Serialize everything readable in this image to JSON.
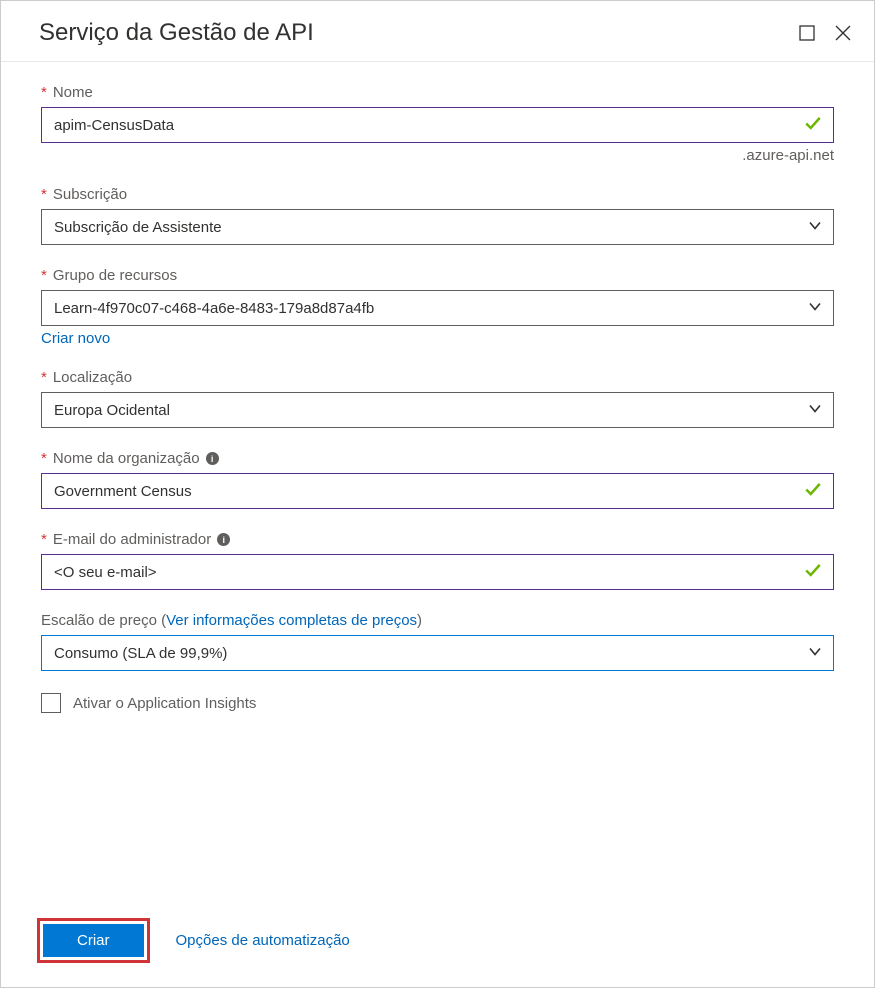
{
  "header": {
    "title": "Serviço da Gestão de API"
  },
  "form": {
    "name": {
      "label": "Nome",
      "value": "apim-CensusData",
      "suffix": ".azure-api.net"
    },
    "subscription": {
      "label": "Subscrição",
      "value": "Subscrição de Assistente"
    },
    "resourceGroup": {
      "label": "Grupo de recursos",
      "value": "Learn-4f970c07-c468-4a6e-8483-179a8d87a4fb",
      "createNew": "Criar novo"
    },
    "location": {
      "label": "Localização",
      "value": "Europa Ocidental"
    },
    "orgName": {
      "label": "Nome da organização",
      "value": "Government Census"
    },
    "adminEmail": {
      "label": "E-mail do administrador",
      "value": "<O seu e-mail>"
    },
    "pricing": {
      "labelPrefix": "Escalão de preço (",
      "linkText": "Ver informações completas de preços",
      "labelSuffix": ")",
      "value": "Consumo (SLA de 99,9%)"
    },
    "appInsights": {
      "label": "Ativar o Application Insights"
    }
  },
  "footer": {
    "createButton": "Criar",
    "automationLink": "Opções de automatização"
  }
}
